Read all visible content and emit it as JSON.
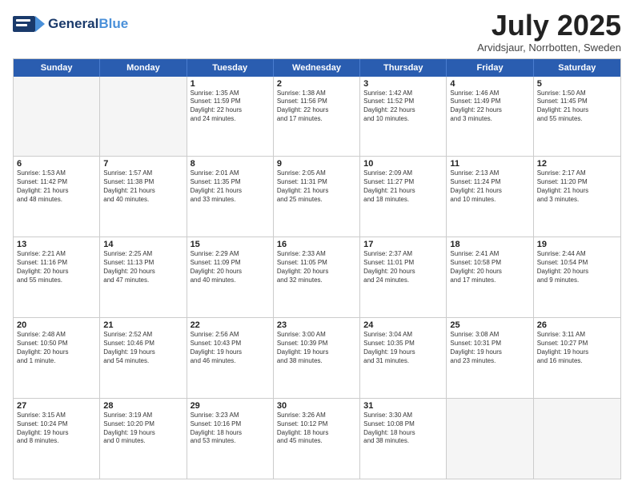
{
  "header": {
    "logo_line1": "General",
    "logo_line2": "Blue",
    "month": "July 2025",
    "location": "Arvidsjaur, Norrbotten, Sweden"
  },
  "weekdays": [
    "Sunday",
    "Monday",
    "Tuesday",
    "Wednesday",
    "Thursday",
    "Friday",
    "Saturday"
  ],
  "weeks": [
    [
      {
        "day": "",
        "lines": []
      },
      {
        "day": "",
        "lines": []
      },
      {
        "day": "1",
        "lines": [
          "Sunrise: 1:35 AM",
          "Sunset: 11:59 PM",
          "Daylight: 22 hours",
          "and 24 minutes."
        ]
      },
      {
        "day": "2",
        "lines": [
          "Sunrise: 1:38 AM",
          "Sunset: 11:56 PM",
          "Daylight: 22 hours",
          "and 17 minutes."
        ]
      },
      {
        "day": "3",
        "lines": [
          "Sunrise: 1:42 AM",
          "Sunset: 11:52 PM",
          "Daylight: 22 hours",
          "and 10 minutes."
        ]
      },
      {
        "day": "4",
        "lines": [
          "Sunrise: 1:46 AM",
          "Sunset: 11:49 PM",
          "Daylight: 22 hours",
          "and 3 minutes."
        ]
      },
      {
        "day": "5",
        "lines": [
          "Sunrise: 1:50 AM",
          "Sunset: 11:45 PM",
          "Daylight: 21 hours",
          "and 55 minutes."
        ]
      }
    ],
    [
      {
        "day": "6",
        "lines": [
          "Sunrise: 1:53 AM",
          "Sunset: 11:42 PM",
          "Daylight: 21 hours",
          "and 48 minutes."
        ]
      },
      {
        "day": "7",
        "lines": [
          "Sunrise: 1:57 AM",
          "Sunset: 11:38 PM",
          "Daylight: 21 hours",
          "and 40 minutes."
        ]
      },
      {
        "day": "8",
        "lines": [
          "Sunrise: 2:01 AM",
          "Sunset: 11:35 PM",
          "Daylight: 21 hours",
          "and 33 minutes."
        ]
      },
      {
        "day": "9",
        "lines": [
          "Sunrise: 2:05 AM",
          "Sunset: 11:31 PM",
          "Daylight: 21 hours",
          "and 25 minutes."
        ]
      },
      {
        "day": "10",
        "lines": [
          "Sunrise: 2:09 AM",
          "Sunset: 11:27 PM",
          "Daylight: 21 hours",
          "and 18 minutes."
        ]
      },
      {
        "day": "11",
        "lines": [
          "Sunrise: 2:13 AM",
          "Sunset: 11:24 PM",
          "Daylight: 21 hours",
          "and 10 minutes."
        ]
      },
      {
        "day": "12",
        "lines": [
          "Sunrise: 2:17 AM",
          "Sunset: 11:20 PM",
          "Daylight: 21 hours",
          "and 3 minutes."
        ]
      }
    ],
    [
      {
        "day": "13",
        "lines": [
          "Sunrise: 2:21 AM",
          "Sunset: 11:16 PM",
          "Daylight: 20 hours",
          "and 55 minutes."
        ]
      },
      {
        "day": "14",
        "lines": [
          "Sunrise: 2:25 AM",
          "Sunset: 11:13 PM",
          "Daylight: 20 hours",
          "and 47 minutes."
        ]
      },
      {
        "day": "15",
        "lines": [
          "Sunrise: 2:29 AM",
          "Sunset: 11:09 PM",
          "Daylight: 20 hours",
          "and 40 minutes."
        ]
      },
      {
        "day": "16",
        "lines": [
          "Sunrise: 2:33 AM",
          "Sunset: 11:05 PM",
          "Daylight: 20 hours",
          "and 32 minutes."
        ]
      },
      {
        "day": "17",
        "lines": [
          "Sunrise: 2:37 AM",
          "Sunset: 11:01 PM",
          "Daylight: 20 hours",
          "and 24 minutes."
        ]
      },
      {
        "day": "18",
        "lines": [
          "Sunrise: 2:41 AM",
          "Sunset: 10:58 PM",
          "Daylight: 20 hours",
          "and 17 minutes."
        ]
      },
      {
        "day": "19",
        "lines": [
          "Sunrise: 2:44 AM",
          "Sunset: 10:54 PM",
          "Daylight: 20 hours",
          "and 9 minutes."
        ]
      }
    ],
    [
      {
        "day": "20",
        "lines": [
          "Sunrise: 2:48 AM",
          "Sunset: 10:50 PM",
          "Daylight: 20 hours",
          "and 1 minute."
        ]
      },
      {
        "day": "21",
        "lines": [
          "Sunrise: 2:52 AM",
          "Sunset: 10:46 PM",
          "Daylight: 19 hours",
          "and 54 minutes."
        ]
      },
      {
        "day": "22",
        "lines": [
          "Sunrise: 2:56 AM",
          "Sunset: 10:43 PM",
          "Daylight: 19 hours",
          "and 46 minutes."
        ]
      },
      {
        "day": "23",
        "lines": [
          "Sunrise: 3:00 AM",
          "Sunset: 10:39 PM",
          "Daylight: 19 hours",
          "and 38 minutes."
        ]
      },
      {
        "day": "24",
        "lines": [
          "Sunrise: 3:04 AM",
          "Sunset: 10:35 PM",
          "Daylight: 19 hours",
          "and 31 minutes."
        ]
      },
      {
        "day": "25",
        "lines": [
          "Sunrise: 3:08 AM",
          "Sunset: 10:31 PM",
          "Daylight: 19 hours",
          "and 23 minutes."
        ]
      },
      {
        "day": "26",
        "lines": [
          "Sunrise: 3:11 AM",
          "Sunset: 10:27 PM",
          "Daylight: 19 hours",
          "and 16 minutes."
        ]
      }
    ],
    [
      {
        "day": "27",
        "lines": [
          "Sunrise: 3:15 AM",
          "Sunset: 10:24 PM",
          "Daylight: 19 hours",
          "and 8 minutes."
        ]
      },
      {
        "day": "28",
        "lines": [
          "Sunrise: 3:19 AM",
          "Sunset: 10:20 PM",
          "Daylight: 19 hours",
          "and 0 minutes."
        ]
      },
      {
        "day": "29",
        "lines": [
          "Sunrise: 3:23 AM",
          "Sunset: 10:16 PM",
          "Daylight: 18 hours",
          "and 53 minutes."
        ]
      },
      {
        "day": "30",
        "lines": [
          "Sunrise: 3:26 AM",
          "Sunset: 10:12 PM",
          "Daylight: 18 hours",
          "and 45 minutes."
        ]
      },
      {
        "day": "31",
        "lines": [
          "Sunrise: 3:30 AM",
          "Sunset: 10:08 PM",
          "Daylight: 18 hours",
          "and 38 minutes."
        ]
      },
      {
        "day": "",
        "lines": []
      },
      {
        "day": "",
        "lines": []
      }
    ]
  ]
}
